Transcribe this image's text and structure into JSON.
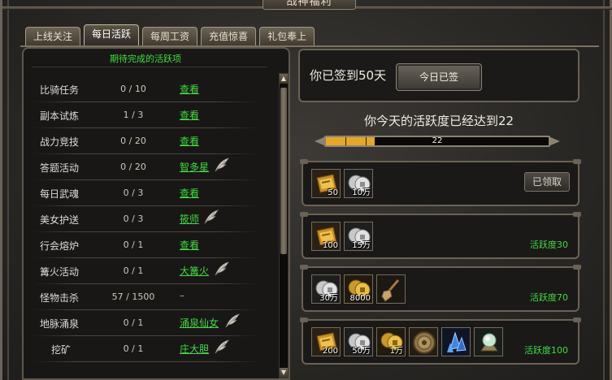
{
  "window": {
    "title": "战神福利"
  },
  "tabs": [
    {
      "label": "上线关注",
      "active": false
    },
    {
      "label": "每日活跃",
      "active": true
    },
    {
      "label": "每周工资",
      "active": false
    },
    {
      "label": "充值惊喜",
      "active": false
    },
    {
      "label": "礼包奉上",
      "active": false
    }
  ],
  "task_panel": {
    "header": "期待完成的活跃项",
    "tasks": [
      {
        "name": "比骑任务",
        "progress": "0 / 10",
        "action": "查看",
        "feather": false
      },
      {
        "name": "副本试炼",
        "progress": "1 / 3",
        "action": "查看",
        "feather": false
      },
      {
        "name": "战力竞技",
        "progress": "0 / 20",
        "action": "查看",
        "feather": false
      },
      {
        "name": "答题活动",
        "progress": "0 / 20",
        "action": "智多星",
        "feather": true
      },
      {
        "name": "每日武魂",
        "progress": "0 / 3",
        "action": "查看",
        "feather": false
      },
      {
        "name": "美女护送",
        "progress": "0 / 3",
        "action": "筱师",
        "feather": true
      },
      {
        "name": "行会熔炉",
        "progress": "0 / 1",
        "action": "查看",
        "feather": false
      },
      {
        "name": "篝火活动",
        "progress": "0 / 1",
        "action": "大篝火",
        "feather": true
      },
      {
        "name": "怪物击杀",
        "progress": "57 / 1500",
        "action": "–",
        "feather": false
      },
      {
        "name": "地脉涌泉",
        "progress": "0 / 1",
        "action": "涌泉仙女",
        "feather": true
      },
      {
        "name": "挖矿",
        "progress": "0 / 1",
        "action": "庄大胆",
        "feather": true
      }
    ]
  },
  "signin": {
    "text": "你已签到50天",
    "button": "今日已签"
  },
  "activity": {
    "text": "你今天的活跃度已经达到22",
    "value": 22,
    "max": 100,
    "bar_label": "22",
    "fill_fraction": 0.22
  },
  "rewards": [
    {
      "items": [
        {
          "icon": "gold-ingot-icon",
          "count": "50"
        },
        {
          "icon": "silver-coin-icon",
          "count": "10万"
        }
      ],
      "status": "已领取",
      "requirement": ""
    },
    {
      "items": [
        {
          "icon": "gold-ingot-icon",
          "count": "100"
        },
        {
          "icon": "silver-coin-icon",
          "count": "15万"
        }
      ],
      "status": "",
      "requirement": "活跃度30"
    },
    {
      "items": [
        {
          "icon": "silver-coin-icon",
          "count": "30万"
        },
        {
          "icon": "gold-coin-icon",
          "count": "8000"
        },
        {
          "icon": "shovel-icon",
          "count": ""
        }
      ],
      "status": "",
      "requirement": "活跃度70"
    },
    {
      "items": [
        {
          "icon": "gold-ingot-icon",
          "count": "200"
        },
        {
          "icon": "silver-coin-icon",
          "count": "50万"
        },
        {
          "icon": "gold-coin-icon",
          "count": "1万"
        },
        {
          "icon": "bronze-medal-icon",
          "count": ""
        },
        {
          "icon": "blue-crystal-icon",
          "count": ""
        },
        {
          "icon": "jade-orb-icon",
          "count": ""
        }
      ],
      "status": "",
      "requirement": "活跃度100"
    }
  ],
  "colors": {
    "green_text": "#3ddc3d",
    "bar_fill": "#e6a626",
    "frame": "#6a6254"
  }
}
